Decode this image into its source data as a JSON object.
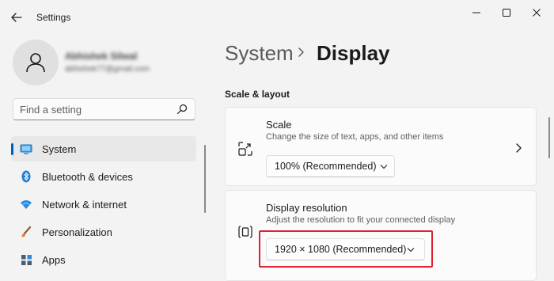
{
  "window": {
    "title": "Settings",
    "controls": [
      "minimize",
      "maximize",
      "close"
    ]
  },
  "profile": {
    "name": "Abhishek Silwal",
    "email": "abhishek77@gmail.com"
  },
  "search": {
    "placeholder": "Find a setting"
  },
  "sidebar": {
    "items": [
      {
        "label": "System",
        "icon": "monitor-icon",
        "active": true
      },
      {
        "label": "Bluetooth & devices",
        "icon": "bluetooth-icon",
        "active": false
      },
      {
        "label": "Network & internet",
        "icon": "wifi-icon",
        "active": false
      },
      {
        "label": "Personalization",
        "icon": "brush-icon",
        "active": false
      },
      {
        "label": "Apps",
        "icon": "apps-icon",
        "active": false
      }
    ]
  },
  "main": {
    "breadcrumb_parent": "System",
    "page_title": "Display",
    "section_heading": "Scale & layout",
    "scale": {
      "title": "Scale",
      "description": "Change the size of text, apps, and other items",
      "value": "100% (Recommended)"
    },
    "resolution": {
      "title": "Display resolution",
      "description": "Adjust the resolution to fit your connected display",
      "value": "1920 × 1080 (Recommended)"
    }
  },
  "colors": {
    "accent": "#005fb8",
    "highlight": "#e02030",
    "background": "#f3f3f3",
    "card": "#fbfbfb"
  }
}
